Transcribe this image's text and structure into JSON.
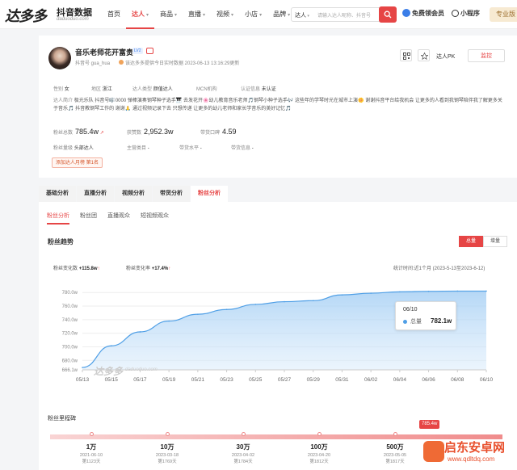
{
  "brand": {
    "logo": "达多多",
    "sub": "抖音数据",
    "url": "daduoduo.com"
  },
  "nav": [
    {
      "label": "首页",
      "caret": false
    },
    {
      "label": "达人",
      "caret": true,
      "active": true
    },
    {
      "label": "商品",
      "caret": true
    },
    {
      "label": "直播",
      "caret": true
    },
    {
      "label": "视频",
      "caret": true
    },
    {
      "label": "小店",
      "caret": true
    },
    {
      "label": "品牌",
      "caret": true
    }
  ],
  "search": {
    "scope": "达人",
    "placeholder": "请输入达人昵称、抖音号"
  },
  "top_right": {
    "member": "免费领会员",
    "mini": "小程序",
    "pro": "专业版"
  },
  "profile": {
    "name": "音乐老师花开富贵",
    "level": "LV2",
    "account": "抖音号 gua_hua",
    "update": "该达多多提供今日实时数据  2023-06-13 13:16:29更新",
    "pk": "达人PK",
    "follow": "监控"
  },
  "info": {
    "gender_label": "性别",
    "gender": "女",
    "region_label": "地区",
    "region": "浙江",
    "type_label": "达人类型",
    "type": "颜值达人",
    "mcn_label": "MCN机构",
    "mcn": "",
    "auth_label": "认证信息",
    "auth": "未认证"
  },
  "intro": {
    "label": "达人简介",
    "text": "极光乐队 抖音号🎼0000 弹棒演奏钢琴种子选手🎹 去发花开🌸幼儿教育音乐老师🎵钢琴小种子选手🎶 这些年的学琴时光在城市上演🌼 谢谢抖音平台给我机会 让更多的人看到我钢琴陪伴我了解更多关于音乐🎵 抖音教钢琴工作的 谢谢🙏 通过视频记录下去 只想传递 让更多的幼儿老师和家长学音乐的美好记忆🎵"
  },
  "stats": [
    {
      "label": "粉丝总数",
      "value": "785.4w"
    },
    {
      "label": "获赞数",
      "value": "2,952.3w"
    },
    {
      "label": "带货口碑",
      "value": "4.59"
    }
  ],
  "levels": [
    {
      "label": "粉丝量级",
      "value": "头部达人"
    },
    {
      "label": "主营类目",
      "value": "-"
    },
    {
      "label": "带货水平",
      "value": "-"
    },
    {
      "label": "带货信息",
      "value": "-"
    }
  ],
  "rank": "添加达人月榜  第1名",
  "tabs": [
    "基础分析",
    "直播分析",
    "视频分析",
    "带货分析",
    "粉丝分析"
  ],
  "subtabs": [
    "粉丝分析",
    "粉丝团",
    "直播观众",
    "短视频观众"
  ],
  "section": {
    "title": "粉丝趋势",
    "toggle_total": "总量",
    "toggle_inc": "增量"
  },
  "kpis": [
    {
      "label": "粉丝变化数",
      "value": "+115.8w"
    },
    {
      "label": "粉丝变化率",
      "value": "+17.4%"
    }
  ],
  "range": "统计时间:近1个月 (2023-5-13至2023-6-12)",
  "chart_data": {
    "type": "area",
    "x": [
      "05/13",
      "05/15",
      "05/17",
      "05/19",
      "05/21",
      "05/23",
      "05/25",
      "05/27",
      "05/29",
      "05/31",
      "06/02",
      "06/04",
      "06/06",
      "06/08",
      "06/10"
    ],
    "series": [
      {
        "name": "总量",
        "values": [
          669.6,
          701.5,
          722.0,
          738.0,
          748.0,
          755.0,
          762.5,
          766.5,
          768.0,
          776.5,
          779.0,
          781.0,
          781.8,
          782.1,
          782.1
        ]
      }
    ],
    "yticks": [
      "666.1w",
      "680.0w",
      "700.0w",
      "720.0w",
      "740.0w",
      "760.0w",
      "780.0w"
    ],
    "ylim": [
      666.1,
      785
    ],
    "tooltip": {
      "date": "06/10",
      "name": "总量",
      "value": "782.1w"
    },
    "color": "#4f9fe6"
  },
  "watermark": {
    "logo": "达多多",
    "url": "daduoduo.com"
  },
  "milestones": {
    "title": "粉丝里程碑",
    "current": "785.4w",
    "items": [
      {
        "n": "1万",
        "d": "2021-06-10",
        "c": "第1123天"
      },
      {
        "n": "10万",
        "d": "2023-03-18",
        "c": "第1769天"
      },
      {
        "n": "30万",
        "d": "2023-04-02",
        "c": "第1784天"
      },
      {
        "n": "100万",
        "d": "2023-04-20",
        "c": "第1812天"
      },
      {
        "n": "500万",
        "d": "2023-05-05",
        "c": "第1817天"
      }
    ]
  },
  "corner_wm": {
    "title": "启东安卓网",
    "url": "www.qdltdq.com"
  }
}
